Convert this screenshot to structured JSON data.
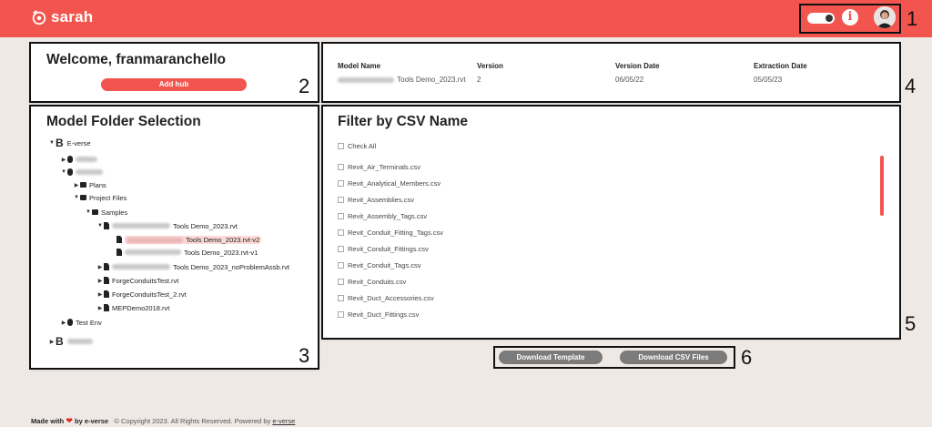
{
  "app": {
    "name": "sarah",
    "brand_color": "#f2554d"
  },
  "header": {
    "info_label": "i",
    "icons": [
      "theme-toggle-icon",
      "info-icon",
      "user-avatar"
    ]
  },
  "welcome": {
    "title": "Welcome, franmaranchello",
    "add_hub_label": "Add hub"
  },
  "model_info": {
    "headers": {
      "model_name": "Model Name",
      "version": "Version",
      "version_date": "Version Date",
      "extraction_date": "Extraction Date"
    },
    "values": {
      "model_name": "Tools Demo_2023.rvt",
      "version": "2",
      "version_date": "06/05/22",
      "extraction_date": "05/05/23"
    }
  },
  "folder_panel": {
    "title": "Model Folder Selection",
    "tree": {
      "hub1": "E-verse",
      "plans": "Plans",
      "project_files": "Project Files",
      "samples": "Samples",
      "file1": "Tools Demo_2023.rvt",
      "file1_v2": "Tools Demo_2023.rvt-v2",
      "file1_v1": "Tools Demo_2023.rvt-v1",
      "file2": "Tools Demo_2023_noProblemAssb.rvt",
      "file3": "ForgeConduitsTest.rvt",
      "file4": "ForgeConduitsTest_2.rvt",
      "file5": "MEPDemo2018.rvt",
      "test_env": "Test Env"
    }
  },
  "csv_panel": {
    "title": "Filter by CSV Name",
    "check_all": "Check All",
    "items": [
      "Revit_Air_Terminals.csv",
      "Revit_Analytical_Members.csv",
      "Revit_Assemblies.csv",
      "Revit_Assembly_Tags.csv",
      "Revit_Conduit_Fitting_Tags.csv",
      "Revit_Conduit_Fittings.csv",
      "Revit_Conduit_Tags.csv",
      "Revit_Conduits.csv",
      "Revit_Duct_Accessories.csv",
      "Revit_Duct_Fittings.csv"
    ]
  },
  "actions": {
    "download_template": "Download Template",
    "download_csv": "Download CSV Files"
  },
  "callouts": [
    "1",
    "2",
    "3",
    "4",
    "5",
    "6"
  ],
  "footer": {
    "made_with": "Made with",
    "heart": "❤",
    "by": "by e-verse",
    "copyright": "© Copyright 2023. All Rights Reserved. Powered by",
    "link": "e-verse"
  }
}
